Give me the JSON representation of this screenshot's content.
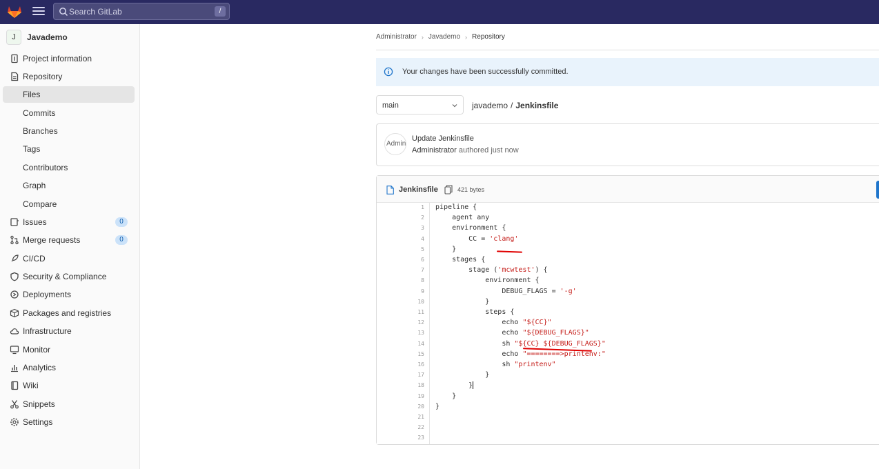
{
  "topbar": {
    "search_placeholder": "Search GitLab",
    "search_shortcut": "/"
  },
  "sidebar": {
    "project_avatar": "J",
    "project_name": "Javademo",
    "items": [
      {
        "label": "Project information",
        "icon": "project-info-icon"
      },
      {
        "label": "Repository",
        "icon": "repository-icon"
      },
      {
        "label": "Files",
        "icon": "",
        "active": true
      },
      {
        "label": "Commits",
        "icon": ""
      },
      {
        "label": "Branches",
        "icon": ""
      },
      {
        "label": "Tags",
        "icon": ""
      },
      {
        "label": "Contributors",
        "icon": ""
      },
      {
        "label": "Graph",
        "icon": ""
      },
      {
        "label": "Compare",
        "icon": ""
      },
      {
        "label": "Issues",
        "icon": "issues-icon",
        "badge": "0"
      },
      {
        "label": "Merge requests",
        "icon": "merge-request-icon",
        "badge": "0"
      },
      {
        "label": "CI/CD",
        "icon": "rocket-icon"
      },
      {
        "label": "Security & Compliance",
        "icon": "shield-icon"
      },
      {
        "label": "Deployments",
        "icon": "deployments-icon"
      },
      {
        "label": "Packages and registries",
        "icon": "package-icon"
      },
      {
        "label": "Infrastructure",
        "icon": "cloud-icon"
      },
      {
        "label": "Monitor",
        "icon": "monitor-icon"
      },
      {
        "label": "Analytics",
        "icon": "chart-icon"
      },
      {
        "label": "Wiki",
        "icon": "book-icon"
      },
      {
        "label": "Snippets",
        "icon": "scissors-icon"
      },
      {
        "label": "Settings",
        "icon": "gear-icon"
      }
    ]
  },
  "breadcrumb": [
    "Administrator",
    "Javademo",
    "Repository"
  ],
  "alert": {
    "message": "Your changes have been successfully committed."
  },
  "branch": {
    "selected": "main"
  },
  "path": {
    "project": "javademo",
    "separator": "/",
    "file": "Jenkinsfile"
  },
  "commit": {
    "avatar_alt": "Admin",
    "title": "Update Jenkinsfile",
    "author": "Administrator",
    "meta": "authored just now"
  },
  "file": {
    "name": "Jenkinsfile",
    "size": "421 bytes"
  },
  "code": [
    [
      {
        "t": "pipeline {"
      }
    ],
    [
      {
        "t": "    agent any"
      }
    ],
    [
      {
        "t": "    environment {"
      }
    ],
    [
      {
        "t": "        CC = "
      },
      {
        "t": "'clang'",
        "s": 1
      }
    ],
    [
      {
        "t": "    }"
      }
    ],
    [
      {
        "t": "    stages {"
      }
    ],
    [
      {
        "t": "        stage ("
      },
      {
        "t": "'mcwtest'",
        "s": 1
      },
      {
        "t": ") {"
      }
    ],
    [
      {
        "t": "            environment {"
      }
    ],
    [
      {
        "t": "                DEBUG_FLAGS = "
      },
      {
        "t": "'-g'",
        "s": 1
      }
    ],
    [
      {
        "t": "            }"
      }
    ],
    [
      {
        "t": "            steps {"
      }
    ],
    [
      {
        "t": "                echo "
      },
      {
        "t": "\"${CC}\"",
        "s": 1
      }
    ],
    [
      {
        "t": "                echo "
      },
      {
        "t": "\"${DEBUG_FLAGS}\"",
        "s": 1
      }
    ],
    [
      {
        "t": "                sh "
      },
      {
        "t": "\"${CC} ${DEBUG_FLAGS}\"",
        "s": 1
      }
    ],
    [
      {
        "t": "                echo "
      },
      {
        "t": "\"========>printenv:\"",
        "s": 1
      }
    ],
    [
      {
        "t": "                sh "
      },
      {
        "t": "\"printenv\"",
        "s": 1
      }
    ],
    [
      {
        "t": "            }"
      }
    ],
    [
      {
        "t": "        }",
        "cursor": true
      }
    ],
    [
      {
        "t": "    }"
      }
    ],
    [
      {
        "t": "}"
      }
    ],
    [],
    [],
    []
  ],
  "colors": {
    "topbar": "#292961",
    "string": "#c41a16",
    "annotation": "#e00000",
    "alert_bg": "#e9f3fc"
  }
}
